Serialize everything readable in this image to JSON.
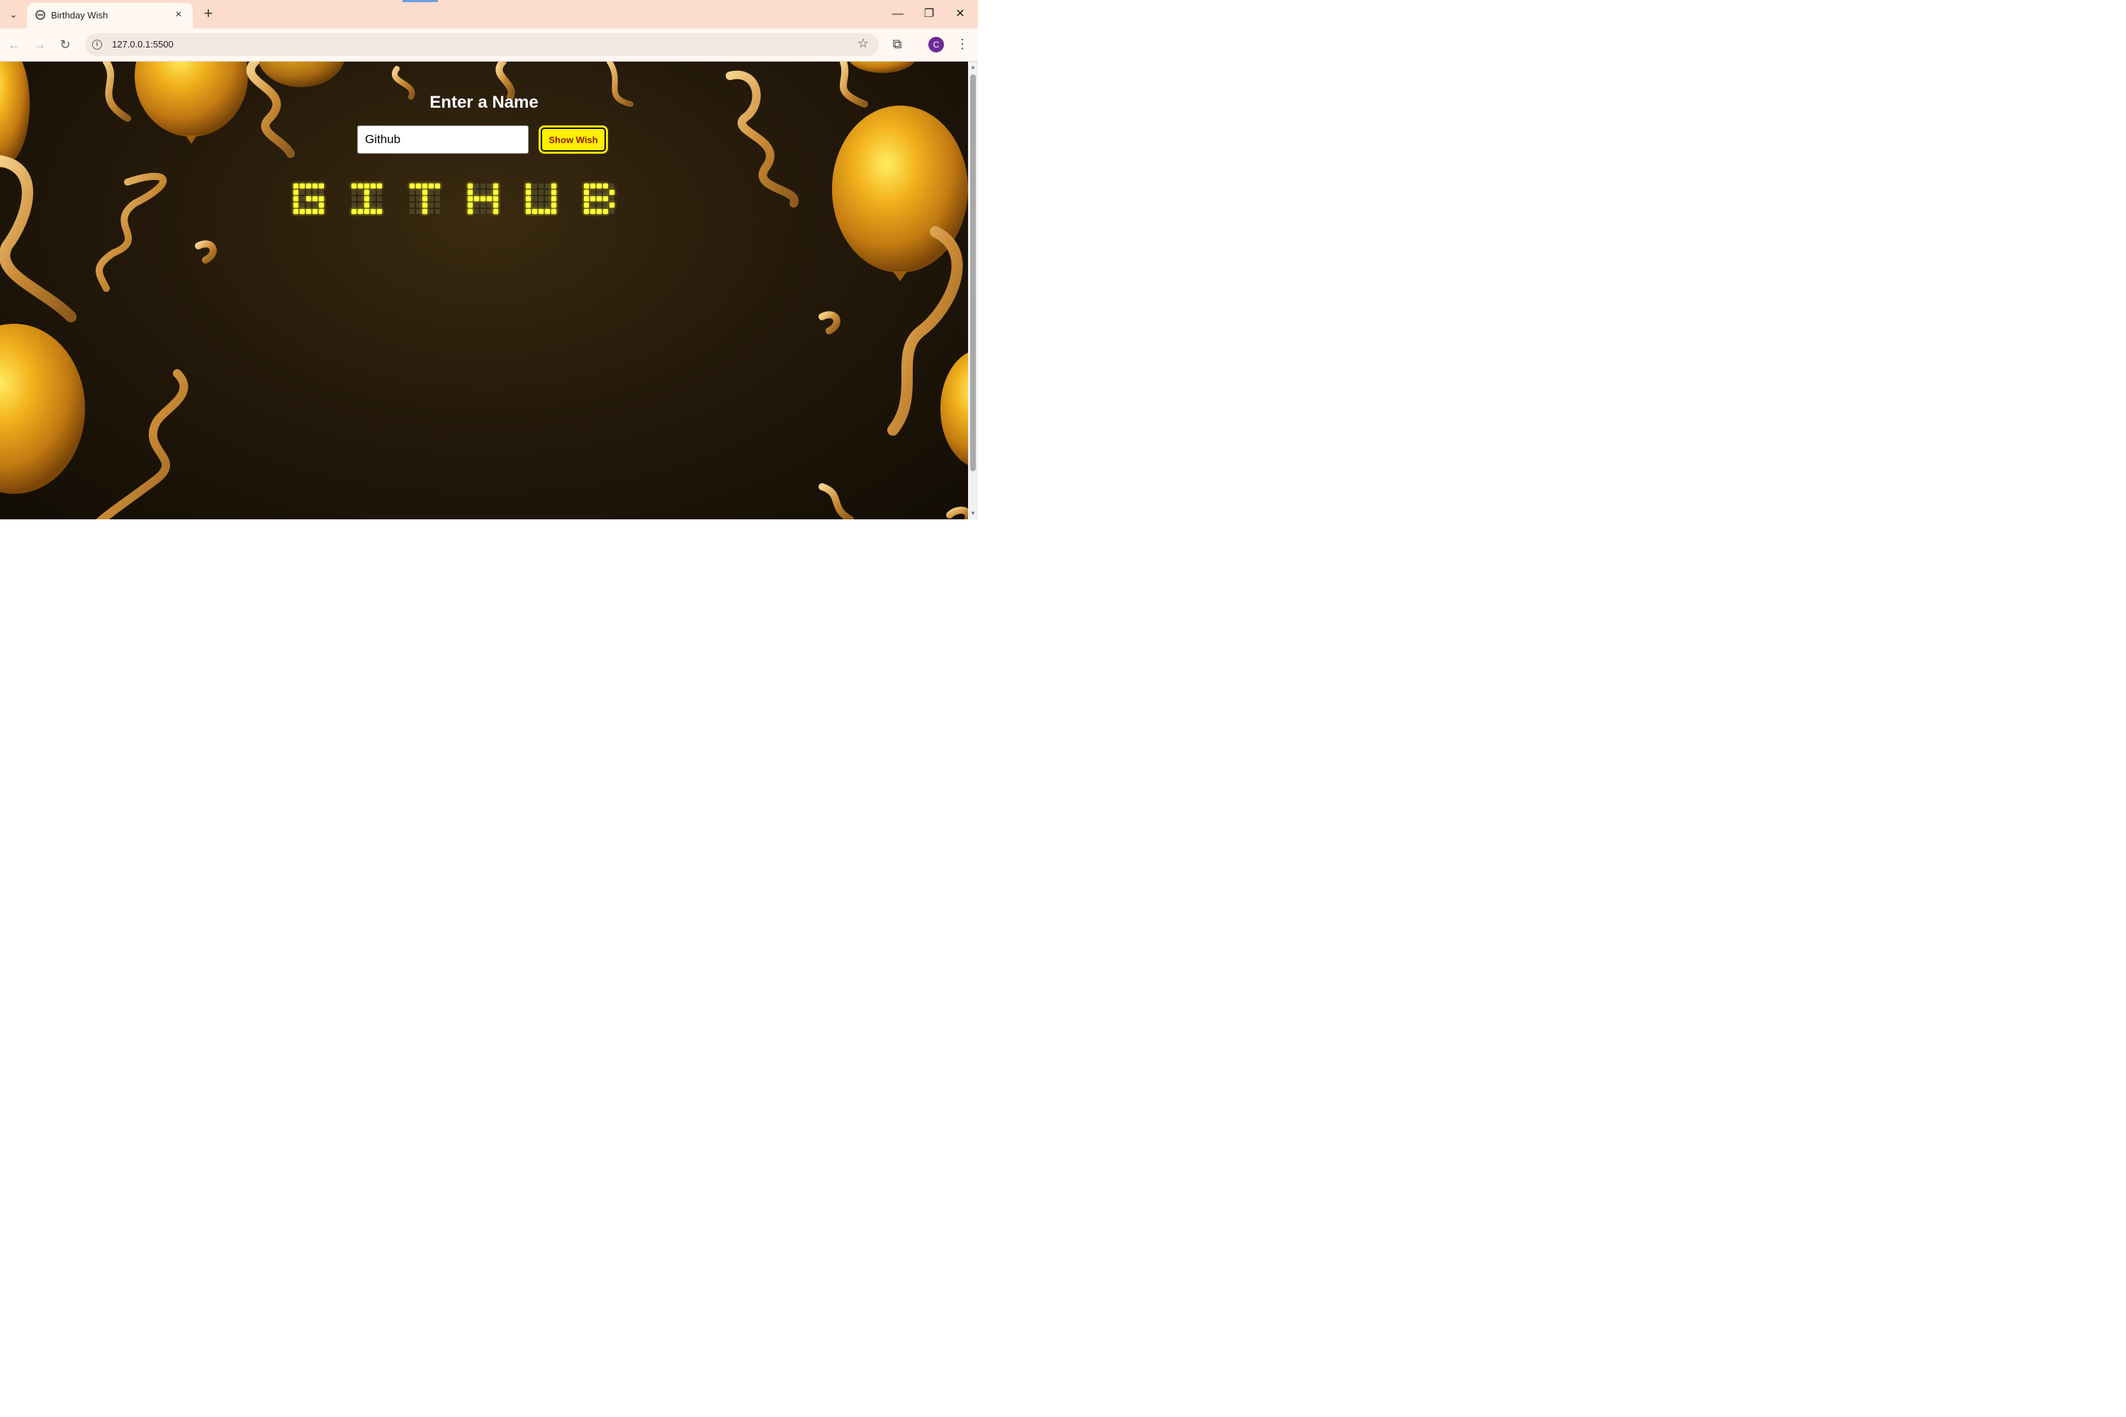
{
  "browser": {
    "tab_title": "Birthday Wish",
    "tab_close": "×",
    "new_tab": "+",
    "tab_list": "⌄",
    "window_controls": {
      "minimize": "—",
      "restore": "❐",
      "close": "✕"
    },
    "toolbar": {
      "back": "←",
      "forward": "→",
      "reload": "↻",
      "url": "127.0.0.1:5500",
      "info": "i",
      "star": "☆",
      "extensions": "⧉",
      "profile_initial": "C",
      "menu": "⋮"
    }
  },
  "page": {
    "heading": "Enter a Name",
    "name_input_value": "Github",
    "show_wish_label": "Show Wish"
  },
  "led_display": {
    "text": "GITHUB",
    "lit_color": "#ffff33",
    "unlit_color": "#4a4324"
  },
  "colors": {
    "tabstrip": "#fcdccc",
    "page_background": "#251a0a",
    "button_yellow": "#ffee00",
    "balloon_gold": "#e0a020"
  }
}
